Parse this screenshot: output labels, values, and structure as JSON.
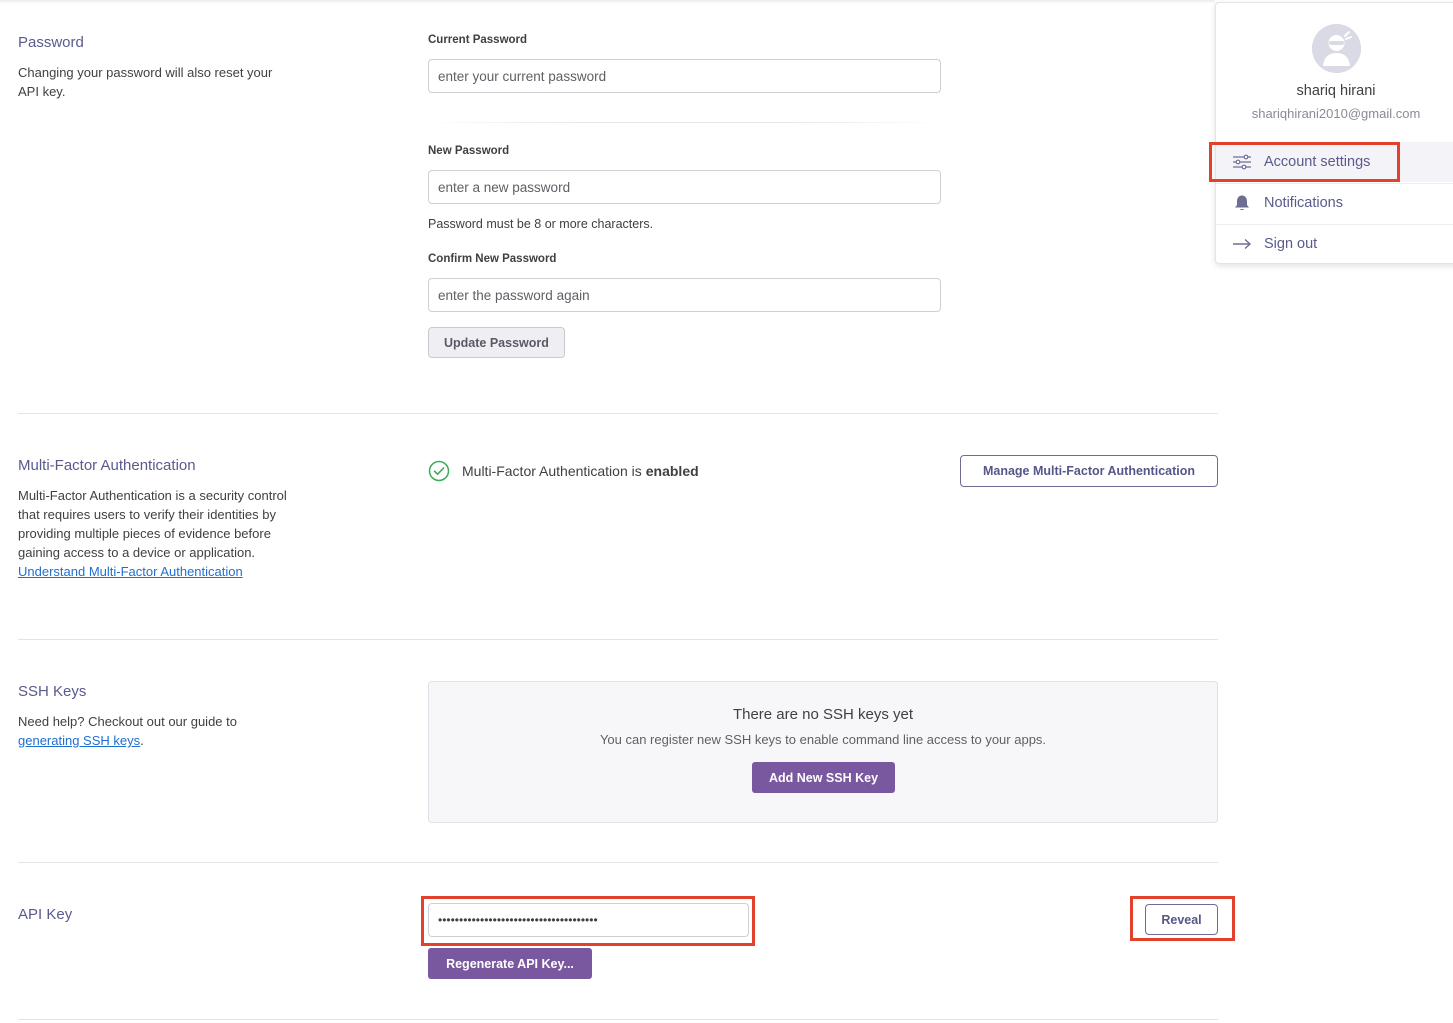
{
  "password": {
    "title": "Password",
    "description": "Changing your password will also reset your API key.",
    "current_label": "Current Password",
    "current_placeholder": "enter your current password",
    "new_label": "New Password",
    "new_placeholder": "enter a new password",
    "hint": "Password must be 8 or more characters.",
    "confirm_label": "Confirm New Password",
    "confirm_placeholder": "enter the password again",
    "update_button": "Update Password"
  },
  "mfa": {
    "title": "Multi-Factor Authentication",
    "description": "Multi-Factor Authentication is a security control that requires users to verify their identities by providing multiple pieces of evidence before gaining access to a device or application.",
    "link": "Understand Multi-Factor Authentication",
    "status_text": "Multi-Factor Authentication is",
    "status_value": "enabled",
    "manage_button": "Manage Multi-Factor Authentication",
    "status_color": "#3cab56"
  },
  "ssh": {
    "title": "SSH Keys",
    "description": "Need help? Checkout out our guide to",
    "link": "generating SSH keys",
    "link_suffix": ".",
    "empty_title": "There are no SSH keys yet",
    "empty_sub": "You can register new SSH keys to enable command line access to your apps.",
    "add_button": "Add New SSH Key"
  },
  "api": {
    "title": "API Key",
    "masked_value": "••••••••••••••••••••••••••••••••••••••",
    "reveal_button": "Reveal",
    "regenerate_button": "Regenerate API Key..."
  },
  "account_menu": {
    "name": "shariq hirani",
    "email": "shariqhirani2010@gmail.com",
    "items": [
      {
        "label": "Account settings",
        "icon": "sliders-icon"
      },
      {
        "label": "Notifications",
        "icon": "bell-icon"
      },
      {
        "label": "Sign out",
        "icon": "arrow-right-icon"
      }
    ]
  },
  "colors": {
    "accent": "#79589f",
    "highlight": "#e2412b",
    "link": "#1f6fd1"
  }
}
